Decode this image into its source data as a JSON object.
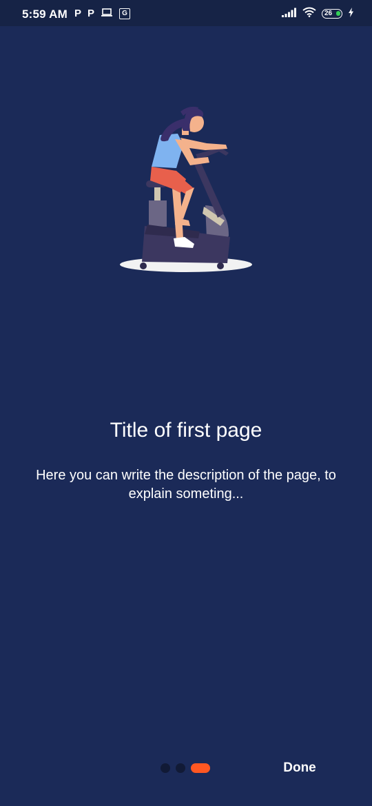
{
  "status_bar": {
    "time": "5:59 AM",
    "left_icons": [
      "p-app-icon",
      "p-app-icon",
      "laptop-icon",
      "translate-icon"
    ],
    "p_glyph": "P",
    "translate_glyph": "G",
    "right_icons": [
      "signal-icon",
      "wifi-icon",
      "battery-icon",
      "charging-icon"
    ],
    "battery_level": "26"
  },
  "illustration": {
    "subject": "woman-on-exercise-bike-icon",
    "colors": {
      "hair": "#3a2f6b",
      "skin": "#f4b28c",
      "top": "#7fb3f0",
      "shorts": "#e8604c",
      "bike": "#3c3760",
      "bike_light": "#cfc6b0",
      "shadow": "#f2f2f2",
      "shoe": "#ffffff"
    }
  },
  "page": {
    "title": "Title of first page",
    "description": "Here you can write the description of the page, to explain someting..."
  },
  "pager": {
    "page_count": 3,
    "active_index": 2,
    "active_color": "#ff5722",
    "inactive_color": "#111a36",
    "done_label": "Done"
  },
  "colors": {
    "background": "#1b2a58",
    "status_bar": "#162346",
    "text": "#ffffff"
  }
}
